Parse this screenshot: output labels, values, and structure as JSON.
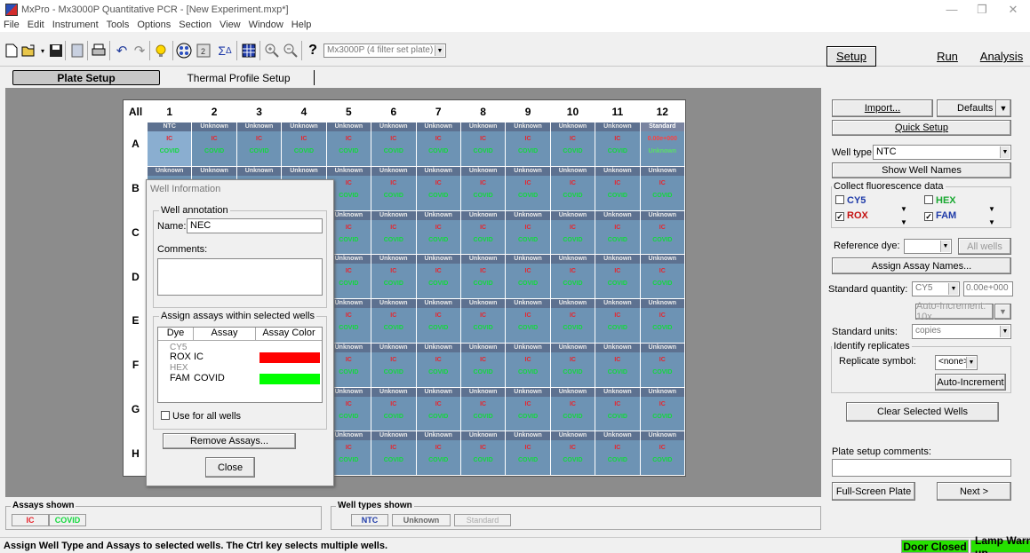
{
  "window": {
    "title": "MxPro - Mx3000P Quantitative PCR - [New Experiment.mxp*]"
  },
  "menu": [
    "File",
    "Edit",
    "Instrument",
    "Tools",
    "Options",
    "Section",
    "View",
    "Window",
    "Help"
  ],
  "toolbar": {
    "plate_select": "Mx3000P (4 filter set plate)"
  },
  "modes": {
    "setup": "Setup",
    "run": "Run",
    "analysis": "Analysis"
  },
  "tabs": {
    "plate_setup": "Plate Setup",
    "thermal": "Thermal Profile Setup"
  },
  "grid": {
    "corner": "All",
    "columns": [
      "1",
      "2",
      "3",
      "4",
      "5",
      "6",
      "7",
      "8",
      "9",
      "10",
      "11",
      "12"
    ],
    "rows": [
      "A",
      "B",
      "C",
      "D",
      "E",
      "F",
      "G",
      "H"
    ],
    "wells": {
      "ntc": "NTC",
      "unknown": "Unknown",
      "standard": "Standard",
      "assay1": "IC",
      "assay2": "COVID",
      "std_qty": "0.00e+000",
      "std_unit": "Unknown"
    }
  },
  "dialog": {
    "title": "Well Information",
    "annotation_group": "Well annotation",
    "name_label": "Name:",
    "name_value": "NEC",
    "comments_label": "Comments:",
    "assign_group": "Assign assays within selected wells",
    "col_dye": "Dye",
    "col_assay": "Assay",
    "col_color": "Assay Color",
    "dyes": [
      {
        "dye": "CY5",
        "assay": "",
        "color": ""
      },
      {
        "dye": "ROX",
        "assay": "IC",
        "color": "#ff0000"
      },
      {
        "dye": "HEX",
        "assay": "",
        "color": ""
      },
      {
        "dye": "FAM",
        "assay": "COVID",
        "color": "#00ff00"
      }
    ],
    "use_all": "Use for all wells",
    "remove": "Remove Assays...",
    "close": "Close"
  },
  "panel": {
    "import": "Import...",
    "defaults": "Defaults",
    "quick_setup": "Quick Setup",
    "well_type_label": "Well type:",
    "well_type_value": "NTC",
    "show_names": "Show Well Names",
    "collect_group": "Collect fluorescence data",
    "cy5": "CY5",
    "hex": "HEX",
    "rox": "ROX",
    "fam": "FAM",
    "ref_dye": "Reference dye:",
    "all_wells": "All wells",
    "assign_names": "Assign Assay Names...",
    "std_qty_label": "Standard quantity:",
    "std_qty_dye": "CY5",
    "std_qty_value": "0.00e+000",
    "auto_inc_10": "Auto-Increment: 10x",
    "std_units_label": "Standard units:",
    "std_units_value": "copies",
    "replicates_group": "Identify replicates",
    "rep_symbol": "Replicate symbol:",
    "rep_value": "<none>",
    "auto_inc": "Auto-Increment",
    "clear": "Clear Selected Wells",
    "comments": "Plate setup comments:",
    "fullscreen": "Full-Screen Plate",
    "next": "Next >"
  },
  "legend": {
    "assays_title": "Assays shown",
    "assay_ic": "IC",
    "assay_covid": "COVID",
    "types_title": "Well types shown",
    "type_ntc": "NTC",
    "type_unknown": "Unknown",
    "type_standard": "Standard"
  },
  "status": {
    "message": "Assign Well Type and Assays to selected wells. The Ctrl key selects multiple wells.",
    "door": "Door Closed",
    "lamp": "Lamp Warm-up"
  },
  "colors": {
    "well": "#6d93b4",
    "ic": "#e8242c",
    "covid": "#12d93c",
    "status": "#26e000"
  }
}
